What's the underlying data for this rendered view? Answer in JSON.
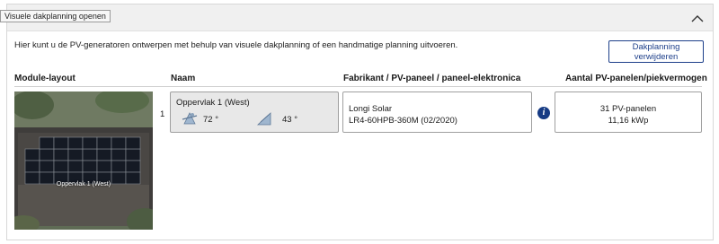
{
  "tooltip": {
    "text": "Visuele dakplanning openen"
  },
  "intro_text": "Hier kunt u de PV-generatoren ontwerpen met behulp van visuele dakplanning of een handmatige planning uitvoeren.",
  "remove_button_label": "Dakplanning verwijderen",
  "columns": {
    "module_layout": "Module-layout",
    "naam": "Naam",
    "fabrikant": "Fabrikant / PV-paneel / paneel-elektronica",
    "aantal": "Aantal PV-panelen/piekvermogen"
  },
  "rows": [
    {
      "index": "1",
      "image_label": "Oppervlak 1 (West)",
      "naam": "Oppervlak 1 (West)",
      "orientation": "72 °",
      "tilt": "43 °",
      "manufacturer": "Longi Solar",
      "panel": "LR4-60HPB-360M (02/2020)",
      "panel_count": "31 PV-panelen",
      "peak_power": "11,16 kWp"
    }
  ],
  "icons": {
    "collapse": "chevron-up-icon",
    "orientation": "compass-orientation-icon",
    "tilt": "tilt-angle-icon",
    "info": "info-icon"
  },
  "colors": {
    "accent": "#1d3f8a",
    "info": "#163b84",
    "header_bg": "#f0f0f0",
    "naam_bg": "#e8e8e8"
  }
}
